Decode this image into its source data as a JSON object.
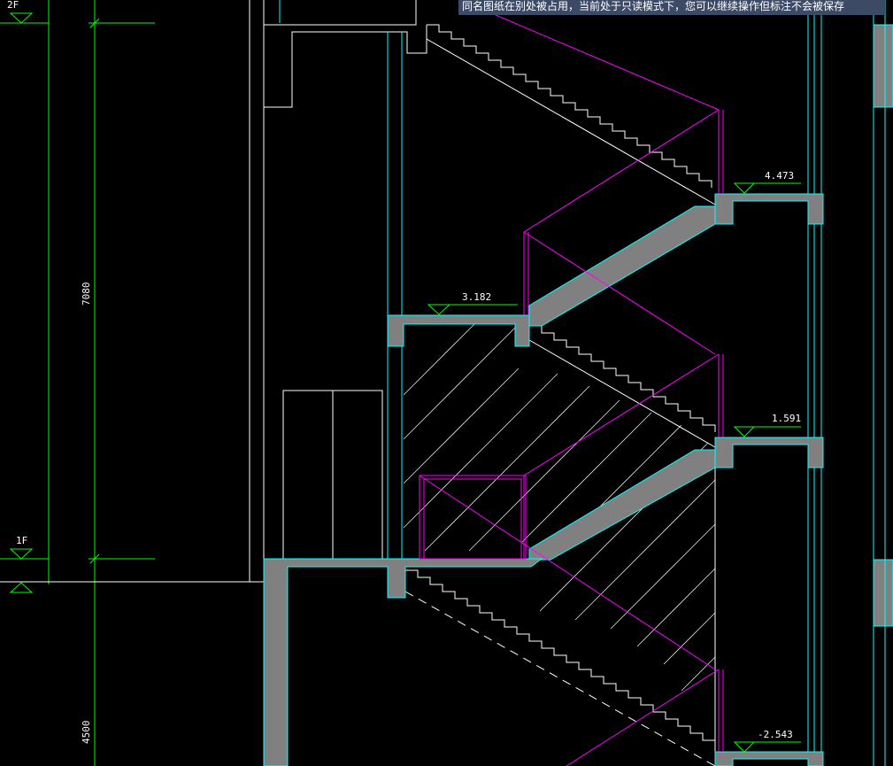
{
  "notice": {
    "text": "同名图纸在别处被占用，当前处于只读模式下，您可以继续操作但标注不会被保存"
  },
  "levels": {
    "floor_2": "2F",
    "floor_1": "1F"
  },
  "elevations": {
    "e4473": "4.473",
    "e3182": "3.182",
    "e1591": "1.591",
    "em2543": "-2.543"
  },
  "dimensions": {
    "d7080": "7080",
    "d4500": "4500"
  },
  "colors": {
    "background": "#000000",
    "concrete_fill": "#808080",
    "outline_cyan": "#00ffff",
    "guide_magenta": "#ff00ff",
    "dimension_green": "#00ff00",
    "linework_white": "#ffffff",
    "notice_bar": "#3d4a66"
  }
}
